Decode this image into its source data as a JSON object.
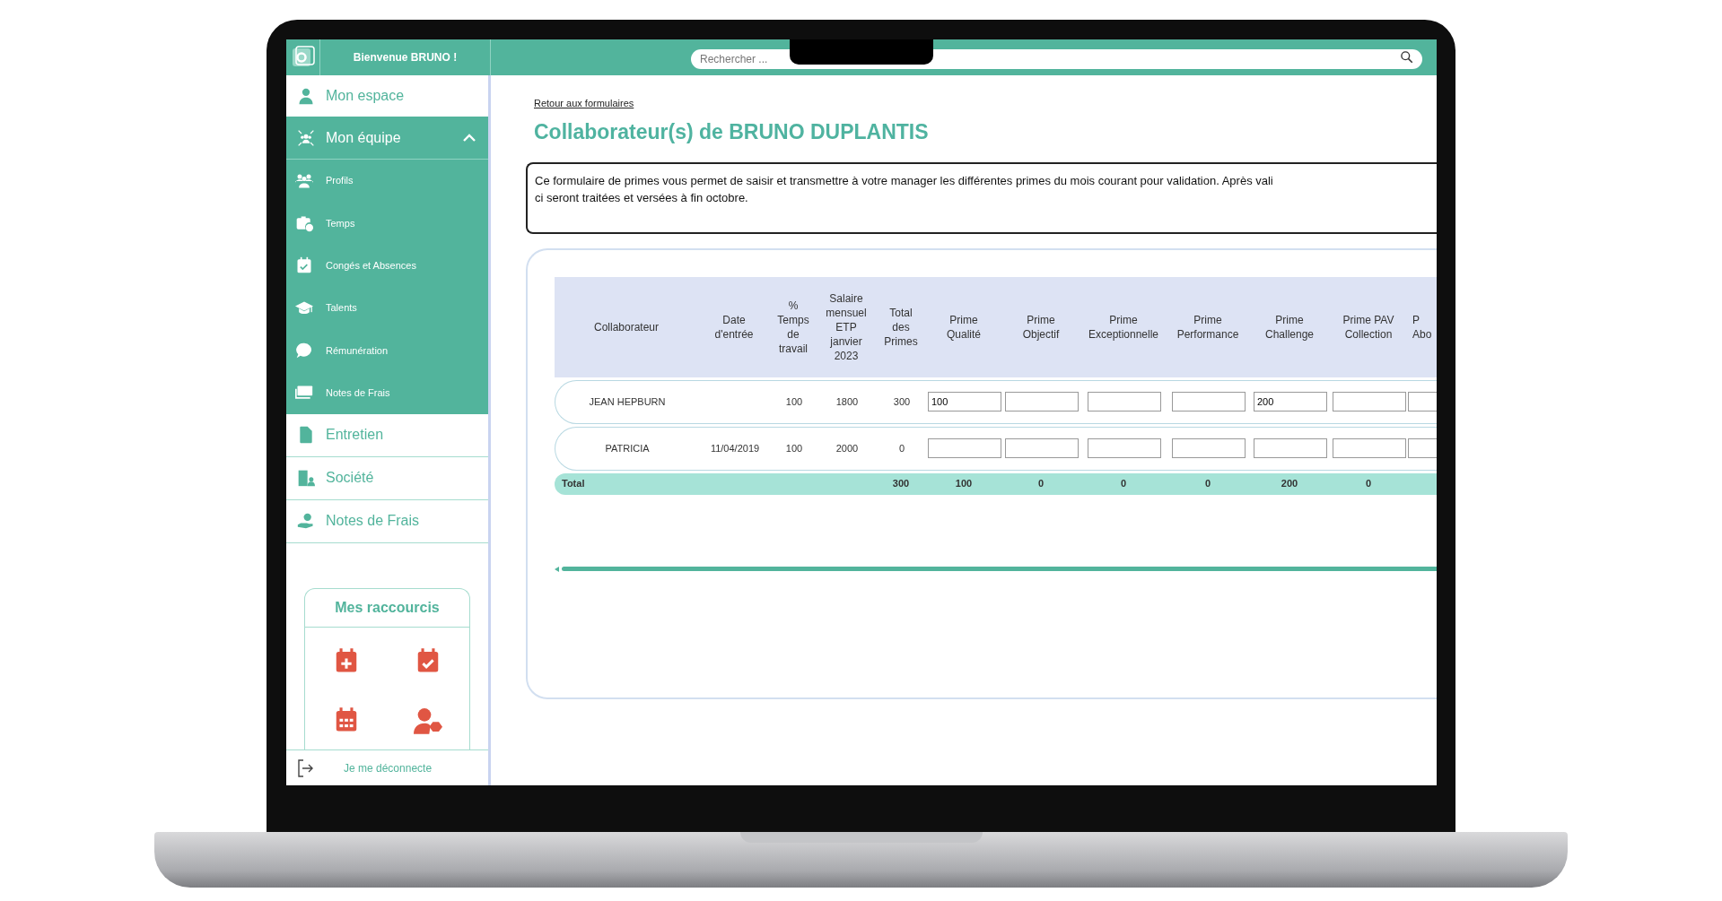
{
  "header": {
    "welcome": "Bienvenue BRUNO !",
    "search": {
      "placeholder": "Rechercher ..."
    }
  },
  "sidebar": {
    "items": [
      {
        "label": "Mon espace"
      },
      {
        "label": "Mon équipe",
        "expanded": true,
        "children": [
          {
            "label": "Profils"
          },
          {
            "label": "Temps"
          },
          {
            "label": "Congés et Absences"
          },
          {
            "label": "Talents"
          },
          {
            "label": "Rémunération"
          },
          {
            "label": "Notes de Frais"
          }
        ]
      },
      {
        "label": "Entretien"
      },
      {
        "label": "Société"
      },
      {
        "label": "Notes de Frais"
      }
    ],
    "shortcuts": {
      "title": "Mes raccourcis"
    },
    "logout": "Je me déconnecte"
  },
  "main": {
    "back_link": "Retour aux formulaires",
    "title": "Collaborateur(s) de BRUNO DUPLANTIS",
    "notice": [
      "Ce formulaire de primes vous permet de saisir et transmettre à votre manager les différentes primes du mois courant pour validation. Après vali",
      "ci seront traitées et versées à fin octobre."
    ],
    "table": {
      "columns": [
        {
          "lines": [
            "Collaborateur"
          ]
        },
        {
          "lines": [
            "Date",
            "d'entrée"
          ]
        },
        {
          "lines": [
            "%",
            "Temps",
            "de",
            "travail"
          ]
        },
        {
          "lines": [
            "Salaire",
            "mensuel",
            "ETP",
            "janvier",
            "2023"
          ]
        },
        {
          "lines": [
            "Total",
            "des",
            "Primes"
          ]
        },
        {
          "lines": [
            "Prime",
            "Qualité"
          ]
        },
        {
          "lines": [
            "Prime",
            "Objectif"
          ]
        },
        {
          "lines": [
            "Prime",
            "Exceptionnelle"
          ]
        },
        {
          "lines": [
            "Prime",
            "Performance"
          ]
        },
        {
          "lines": [
            "Prime",
            "Challenge"
          ]
        },
        {
          "lines": [
            "Prime PAV",
            "Collection"
          ]
        },
        {
          "lines": [
            "P",
            "Abo"
          ]
        }
      ],
      "rows": [
        {
          "cells": {
            "collaborateur": "JEAN HEPBURN",
            "temps": "100",
            "salaire": "1800",
            "total": "300"
          },
          "inputs": [
            {
              "kind": "filled",
              "value": "100"
            },
            {
              "kind": "empty"
            },
            {
              "kind": "empty"
            },
            {
              "kind": "empty"
            },
            {
              "kind": "filled",
              "value": "200"
            },
            {
              "kind": "empty"
            },
            {
              "kind": "empty"
            }
          ]
        },
        {
          "cells": {
            "collaborateur": "PATRICIA",
            "date_entree": "11/04/2019",
            "temps": "100",
            "salaire": "2000",
            "total": "0"
          },
          "inputs": [
            {
              "kind": "empty"
            },
            {
              "kind": "empty"
            },
            {
              "kind": "empty"
            },
            {
              "kind": "empty"
            },
            {
              "kind": "empty"
            },
            {
              "kind": "empty"
            },
            {
              "kind": "empty"
            }
          ]
        }
      ],
      "total": {
        "label": "Total",
        "values": [
          "300",
          "100",
          "0",
          "0",
          "0",
          "200",
          "0"
        ]
      }
    }
  }
}
